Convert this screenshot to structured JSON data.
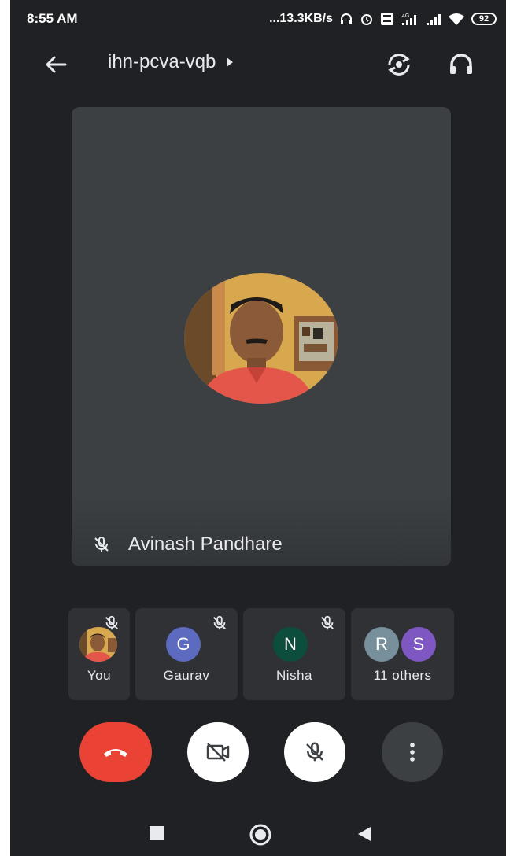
{
  "status_bar": {
    "time": "8:55 AM",
    "speed": "...13.3KB/s",
    "battery": "92",
    "icons": [
      "headset-status-icon",
      "alarm-icon",
      "volte-icon",
      "signal-4g-icon",
      "signal-icon",
      "wifi-icon",
      "battery-icon"
    ]
  },
  "header": {
    "meeting_code": "ihn-pcva-vqb",
    "back_icon": "arrow-back-icon",
    "switch_camera_icon": "switch-camera-icon",
    "audio_icon": "headphones-icon"
  },
  "main_speaker": {
    "name": "Avinash Pandhare",
    "muted": true
  },
  "participants": [
    {
      "label": "You",
      "initial": "",
      "muted": true
    },
    {
      "label": "Gaurav",
      "initial": "G",
      "color": "#5c6bc0",
      "muted": true
    },
    {
      "label": "Nisha",
      "initial": "N",
      "color": "#0d4d3e",
      "muted": true
    },
    {
      "label": "11 others",
      "initials": [
        "R",
        "S"
      ],
      "colors": [
        "#78909c",
        "#7e57c2"
      ]
    }
  ],
  "controls": {
    "end_call": "end-call-icon",
    "camera": "camera-off-icon",
    "mic": "mic-off-icon",
    "more": "more-vert-icon"
  },
  "colors": {
    "background": "#202124",
    "tile": "#3c4043",
    "end_call": "#ea4335"
  }
}
